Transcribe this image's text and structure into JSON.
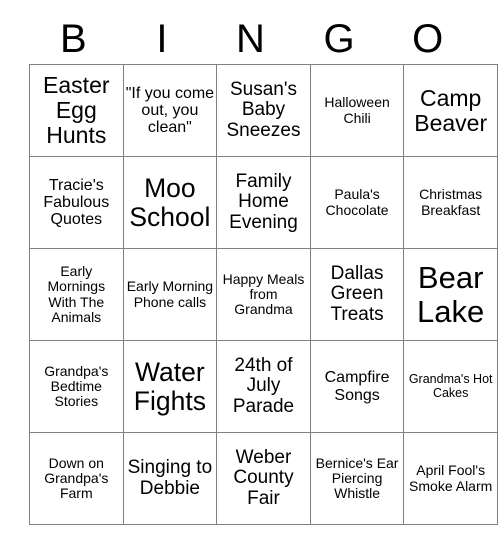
{
  "card": {
    "header_letters": [
      "B",
      "I",
      "N",
      "G",
      "O"
    ],
    "rows": [
      [
        {
          "text": "Easter Egg Hunts",
          "size": "fs-xl"
        },
        {
          "text": "\"If you come out, you clean\"",
          "size": "fs-md"
        },
        {
          "text": "Susan's Baby Sneezes",
          "size": "fs-lg"
        },
        {
          "text": "Halloween Chili",
          "size": "fs-sm"
        },
        {
          "text": "Camp Beaver",
          "size": "fs-xl"
        }
      ],
      [
        {
          "text": "Tracie's Fabulous Quotes",
          "size": "fs-md"
        },
        {
          "text": "Moo School",
          "size": "fs-2xl"
        },
        {
          "text": "Family Home Evening",
          "size": "fs-lg"
        },
        {
          "text": "Paula's Chocolate",
          "size": "fs-sm"
        },
        {
          "text": "Christmas Breakfast",
          "size": "fs-sm"
        }
      ],
      [
        {
          "text": "Early Mornings With The Animals",
          "size": "fs-sm"
        },
        {
          "text": "Early Morning Phone calls",
          "size": "fs-sm"
        },
        {
          "text": "Happy Meals from Grandma",
          "size": "fs-sm"
        },
        {
          "text": "Dallas Green Treats",
          "size": "fs-lg"
        },
        {
          "text": "Bear Lake",
          "size": "fs-3xl"
        }
      ],
      [
        {
          "text": "Grandpa's Bedtime Stories",
          "size": "fs-sm"
        },
        {
          "text": "Water Fights",
          "size": "fs-2xl"
        },
        {
          "text": "24th of July Parade",
          "size": "fs-lg"
        },
        {
          "text": "Campfire Songs",
          "size": "fs-md"
        },
        {
          "text": "Grandma's Hot Cakes",
          "size": "fs-xs"
        }
      ],
      [
        {
          "text": "Down on Grandpa's Farm",
          "size": "fs-sm"
        },
        {
          "text": "Singing to Debbie",
          "size": "fs-lg"
        },
        {
          "text": "Weber County Fair",
          "size": "fs-lg"
        },
        {
          "text": "Bernice's Ear Piercing Whistle",
          "size": "fs-sm"
        },
        {
          "text": "April Fool's Smoke Alarm",
          "size": "fs-sm"
        }
      ]
    ]
  }
}
